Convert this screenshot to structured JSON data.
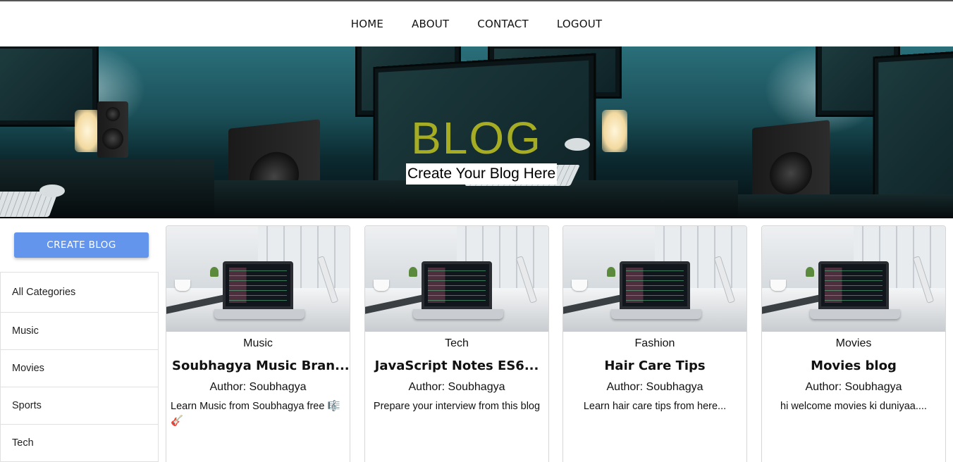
{
  "nav": {
    "links": [
      "HOME",
      "ABOUT",
      "CONTACT",
      "LOGOUT"
    ]
  },
  "hero": {
    "title": "BLOG",
    "subtitle": "Create Your Blog Here",
    "title_color": "#a6ad22"
  },
  "sidebar": {
    "create_button_label": "CREATE BLOG",
    "button_color": "#6495ed",
    "categories": [
      "All Categories",
      "Music",
      "Movies",
      "Sports",
      "Tech"
    ]
  },
  "posts": [
    {
      "category": "Music",
      "title": "Soubhagya Music Bran...",
      "author": "Author: Soubhagya",
      "description": "Learn Music from Soubhagya free 🎼🎸"
    },
    {
      "category": "Tech",
      "title": "JavaScript Notes ES6...",
      "author": "Author: Soubhagya",
      "description": "Prepare your interview from this blog"
    },
    {
      "category": "Fashion",
      "title": "Hair Care Tips",
      "author": "Author: Soubhagya",
      "description": "Learn hair care tips from here..."
    },
    {
      "category": "Movies",
      "title": "Movies blog",
      "author": "Author: Soubhagya",
      "description": "hi welcome movies ki duniyaa...."
    }
  ]
}
